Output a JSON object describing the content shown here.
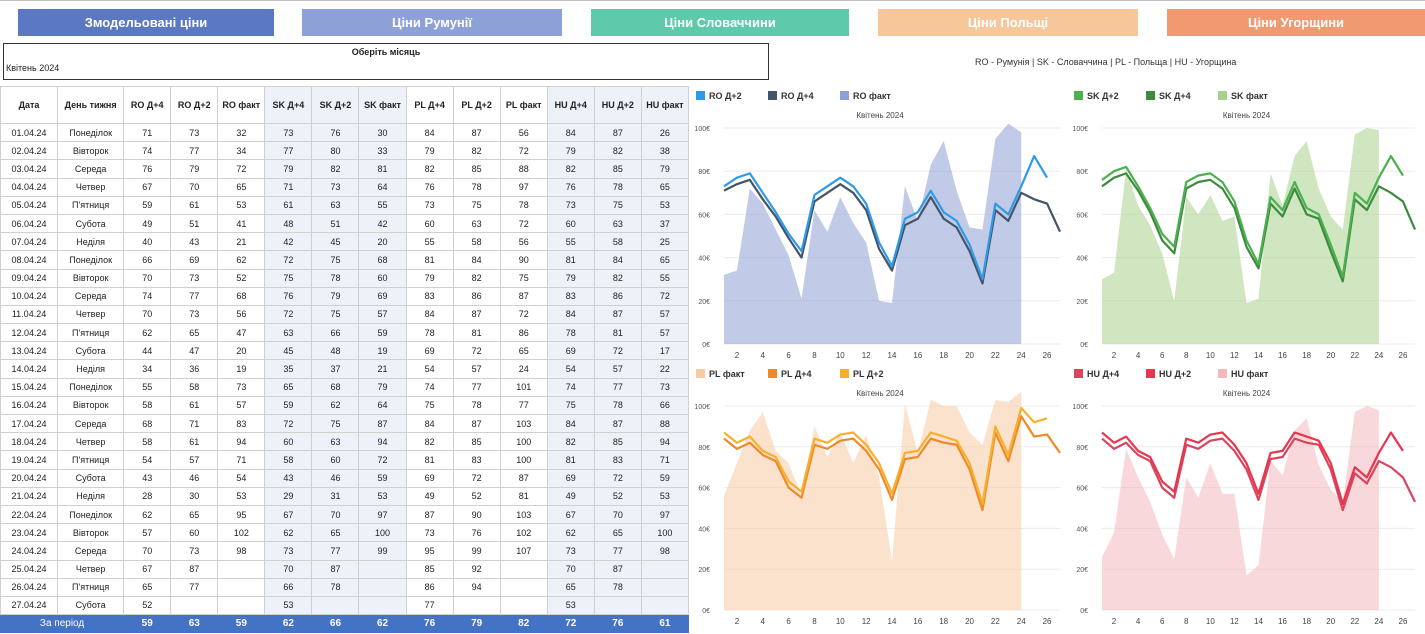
{
  "tabs": [
    {
      "label": "Змодельовані ціни",
      "color": "#5b78c2"
    },
    {
      "label": "Ціни Румунії",
      "color": "#8ea1d6"
    },
    {
      "label": "Ціни Словаччини",
      "color": "#5ecaa9"
    },
    {
      "label": "Ціни Польщі",
      "color": "#f5c79a"
    },
    {
      "label": "Ціни Угорщини",
      "color": "#f19a72"
    }
  ],
  "month_selector": {
    "title": "Оберіть місяць",
    "value": "Квітень 2024"
  },
  "country_legend": "RO - Румунія  |  SK - Словаччина  |  PL - Польща  |  HU - Угорщина",
  "table": {
    "headers": [
      "Дата",
      "День тижня",
      "RO Д+4",
      "RO Д+2",
      "RO факт",
      "SK Д+4",
      "SK Д+2",
      "SK факт",
      "PL Д+4",
      "PL Д+2",
      "PL факт",
      "HU Д+4",
      "HU Д+2",
      "HU факт"
    ],
    "rows": [
      [
        "01.04.24",
        "Понеділок",
        "71",
        "73",
        "32",
        "73",
        "76",
        "30",
        "84",
        "87",
        "56",
        "84",
        "87",
        "26"
      ],
      [
        "02.04.24",
        "Вівторок",
        "74",
        "77",
        "34",
        "77",
        "80",
        "33",
        "79",
        "82",
        "72",
        "79",
        "82",
        "38"
      ],
      [
        "03.04.24",
        "Середа",
        "76",
        "79",
        "72",
        "79",
        "82",
        "81",
        "82",
        "85",
        "88",
        "82",
        "85",
        "79"
      ],
      [
        "04.04.24",
        "Четвер",
        "67",
        "70",
        "65",
        "71",
        "73",
        "64",
        "76",
        "78",
        "97",
        "76",
        "78",
        "65"
      ],
      [
        "05.04.24",
        "П'ятниця",
        "59",
        "61",
        "53",
        "61",
        "63",
        "55",
        "73",
        "75",
        "78",
        "73",
        "75",
        "53"
      ],
      [
        "06.04.24",
        "Субота",
        "49",
        "51",
        "41",
        "48",
        "51",
        "42",
        "60",
        "63",
        "72",
        "60",
        "63",
        "37"
      ],
      [
        "07.04.24",
        "Неділя",
        "40",
        "43",
        "21",
        "42",
        "45",
        "20",
        "55",
        "58",
        "56",
        "55",
        "58",
        "25"
      ],
      [
        "08.04.24",
        "Понеділок",
        "66",
        "69",
        "62",
        "72",
        "75",
        "68",
        "81",
        "84",
        "90",
        "81",
        "84",
        "65"
      ],
      [
        "09.04.24",
        "Вівторок",
        "70",
        "73",
        "52",
        "75",
        "78",
        "60",
        "79",
        "82",
        "75",
        "79",
        "82",
        "55"
      ],
      [
        "10.04.24",
        "Середа",
        "74",
        "77",
        "68",
        "76",
        "79",
        "69",
        "83",
        "86",
        "87",
        "83",
        "86",
        "72"
      ],
      [
        "11.04.24",
        "Четвер",
        "70",
        "73",
        "56",
        "72",
        "75",
        "57",
        "84",
        "87",
        "72",
        "84",
        "87",
        "57"
      ],
      [
        "12.04.24",
        "П'ятниця",
        "62",
        "65",
        "47",
        "63",
        "66",
        "59",
        "78",
        "81",
        "86",
        "78",
        "81",
        "57"
      ],
      [
        "13.04.24",
        "Субота",
        "44",
        "47",
        "20",
        "45",
        "48",
        "19",
        "69",
        "72",
        "65",
        "69",
        "72",
        "17"
      ],
      [
        "14.04.24",
        "Неділя",
        "34",
        "36",
        "19",
        "35",
        "37",
        "21",
        "54",
        "57",
        "24",
        "54",
        "57",
        "22"
      ],
      [
        "15.04.24",
        "Понеділок",
        "55",
        "58",
        "73",
        "65",
        "68",
        "79",
        "74",
        "77",
        "101",
        "74",
        "77",
        "73"
      ],
      [
        "16.04.24",
        "Вівторок",
        "58",
        "61",
        "57",
        "59",
        "62",
        "64",
        "75",
        "78",
        "77",
        "75",
        "78",
        "66"
      ],
      [
        "17.04.24",
        "Середа",
        "68",
        "71",
        "83",
        "72",
        "75",
        "87",
        "84",
        "87",
        "103",
        "84",
        "87",
        "88"
      ],
      [
        "18.04.24",
        "Четвер",
        "58",
        "61",
        "94",
        "60",
        "63",
        "94",
        "82",
        "85",
        "100",
        "82",
        "85",
        "94"
      ],
      [
        "19.04.24",
        "П'ятниця",
        "54",
        "57",
        "71",
        "58",
        "60",
        "72",
        "81",
        "83",
        "100",
        "81",
        "83",
        "71"
      ],
      [
        "20.04.24",
        "Субота",
        "43",
        "46",
        "54",
        "43",
        "46",
        "59",
        "69",
        "72",
        "87",
        "69",
        "72",
        "59"
      ],
      [
        "21.04.24",
        "Неділя",
        "28",
        "30",
        "53",
        "29",
        "31",
        "53",
        "49",
        "52",
        "81",
        "49",
        "52",
        "53"
      ],
      [
        "22.04.24",
        "Понеділок",
        "62",
        "65",
        "95",
        "67",
        "70",
        "97",
        "87",
        "90",
        "103",
        "67",
        "70",
        "97"
      ],
      [
        "23.04.24",
        "Вівторок",
        "57",
        "60",
        "102",
        "62",
        "65",
        "100",
        "73",
        "76",
        "102",
        "62",
        "65",
        "100"
      ],
      [
        "24.04.24",
        "Середа",
        "70",
        "73",
        "98",
        "73",
        "77",
        "99",
        "95",
        "99",
        "107",
        "73",
        "77",
        "98"
      ],
      [
        "25.04.24",
        "Четвер",
        "67",
        "87",
        "",
        "70",
        "87",
        "",
        "85",
        "92",
        "",
        "70",
        "87",
        ""
      ],
      [
        "26.04.24",
        "П'ятниця",
        "65",
        "77",
        "",
        "66",
        "78",
        "",
        "86",
        "94",
        "",
        "65",
        "78",
        ""
      ],
      [
        "27.04.24",
        "Субота",
        "52",
        "",
        "",
        "53",
        "",
        "",
        "77",
        "",
        "",
        "53",
        "",
        ""
      ]
    ],
    "total": [
      "За період",
      "",
      "59",
      "63",
      "59",
      "62",
      "66",
      "62",
      "76",
      "79",
      "82",
      "72",
      "76",
      "61"
    ]
  },
  "chart_data": [
    {
      "type": "area",
      "title": "Квітень 2024",
      "legend": [
        "RO Д+2",
        "RO Д+4",
        "RO факт"
      ],
      "colors": {
        "d2": "#2e9be8",
        "d4": "#44546a",
        "fact": "#8ea1d6"
      },
      "ylim": [
        0,
        100
      ],
      "yticks": [
        "0€",
        "20€",
        "40€",
        "60€",
        "80€",
        "100€"
      ],
      "xticks": [
        "2",
        "4",
        "6",
        "8",
        "10",
        "12",
        "14",
        "16",
        "18",
        "20",
        "22",
        "24",
        "26"
      ],
      "series": {
        "d4": [
          71,
          74,
          76,
          67,
          59,
          49,
          40,
          66,
          70,
          74,
          70,
          62,
          44,
          34,
          55,
          58,
          68,
          58,
          54,
          43,
          28,
          62,
          57,
          70,
          67,
          65,
          52
        ],
        "d2": [
          73,
          77,
          79,
          70,
          61,
          51,
          43,
          69,
          73,
          77,
          73,
          65,
          47,
          36,
          58,
          61,
          71,
          61,
          57,
          46,
          30,
          65,
          60,
          73,
          87,
          77
        ],
        "fact": [
          32,
          34,
          72,
          65,
          53,
          41,
          21,
          62,
          52,
          68,
          56,
          47,
          20,
          19,
          73,
          57,
          83,
          94,
          71,
          54,
          53,
          95,
          102,
          98
        ]
      }
    },
    {
      "type": "area",
      "title": "Квітень 2024",
      "legend": [
        "SK Д+2",
        "SK Д+4",
        "SK факт"
      ],
      "colors": {
        "d2": "#4caf50",
        "d4": "#3d8b3d",
        "fact": "#a9d18e"
      },
      "ylim": [
        0,
        100
      ],
      "yticks": [
        "0€",
        "20€",
        "40€",
        "60€",
        "80€",
        "100€"
      ],
      "xticks": [
        "2",
        "4",
        "6",
        "8",
        "10",
        "12",
        "14",
        "16",
        "18",
        "20",
        "22",
        "24",
        "26"
      ],
      "series": {
        "d4": [
          73,
          77,
          79,
          71,
          61,
          48,
          42,
          72,
          75,
          76,
          72,
          63,
          45,
          35,
          65,
          59,
          72,
          60,
          58,
          43,
          29,
          67,
          62,
          73,
          70,
          66,
          53
        ],
        "d2": [
          76,
          80,
          82,
          73,
          63,
          51,
          45,
          75,
          78,
          79,
          75,
          66,
          48,
          37,
          68,
          62,
          75,
          63,
          60,
          46,
          31,
          70,
          65,
          77,
          87,
          78
        ],
        "fact": [
          30,
          33,
          81,
          64,
          55,
          42,
          20,
          68,
          60,
          69,
          57,
          59,
          19,
          21,
          79,
          64,
          87,
          94,
          72,
          59,
          53,
          97,
          100,
          99
        ]
      }
    },
    {
      "type": "area",
      "title": "Квітень 2024",
      "legend": [
        "PL факт",
        "PL Д+4",
        "PL Д+2"
      ],
      "colors": {
        "d2": "#f6b02e",
        "d4": "#ef8a2a",
        "fact": "#f8cba4"
      },
      "ylim": [
        0,
        100
      ],
      "yticks": [
        "0€",
        "20€",
        "40€",
        "60€",
        "80€",
        "100€"
      ],
      "xticks": [
        "2",
        "4",
        "6",
        "8",
        "10",
        "12",
        "14",
        "16",
        "18",
        "20",
        "22",
        "24",
        "26"
      ],
      "series": {
        "d4": [
          84,
          79,
          82,
          76,
          73,
          60,
          55,
          81,
          79,
          83,
          84,
          78,
          69,
          54,
          74,
          75,
          84,
          82,
          81,
          69,
          49,
          87,
          73,
          95,
          85,
          86,
          77
        ],
        "d2": [
          87,
          82,
          85,
          78,
          75,
          63,
          58,
          84,
          82,
          86,
          87,
          81,
          72,
          57,
          77,
          78,
          87,
          85,
          83,
          72,
          52,
          90,
          76,
          99,
          92,
          94
        ],
        "fact": [
          56,
          72,
          88,
          97,
          78,
          72,
          56,
          90,
          75,
          87,
          72,
          86,
          65,
          24,
          101,
          77,
          103,
          100,
          100,
          87,
          81,
          103,
          102,
          107
        ]
      }
    },
    {
      "type": "area",
      "title": "Квітень 2024",
      "legend": [
        "HU Д+4",
        "HU Д+2",
        "HU факт"
      ],
      "colors": {
        "d2": "#e8364f",
        "d4": "#d9455d",
        "fact": "#f2b8bc"
      },
      "ylim": [
        0,
        100
      ],
      "yticks": [
        "0€",
        "20€",
        "40€",
        "60€",
        "80€",
        "100€"
      ],
      "xticks": [
        "2",
        "4",
        "6",
        "8",
        "10",
        "12",
        "14",
        "16",
        "18",
        "20",
        "22",
        "24",
        "26"
      ],
      "series": {
        "d4": [
          84,
          79,
          82,
          76,
          73,
          60,
          55,
          81,
          79,
          83,
          84,
          78,
          69,
          54,
          74,
          75,
          84,
          82,
          81,
          69,
          49,
          67,
          62,
          73,
          70,
          65,
          53
        ],
        "d2": [
          87,
          82,
          85,
          78,
          75,
          63,
          58,
          84,
          82,
          86,
          87,
          81,
          72,
          57,
          77,
          78,
          87,
          85,
          83,
          72,
          52,
          70,
          65,
          77,
          87,
          78
        ],
        "fact": [
          26,
          38,
          79,
          65,
          53,
          37,
          25,
          65,
          55,
          72,
          57,
          57,
          17,
          22,
          73,
          66,
          88,
          94,
          71,
          59,
          53,
          97,
          100,
          98
        ]
      }
    }
  ]
}
